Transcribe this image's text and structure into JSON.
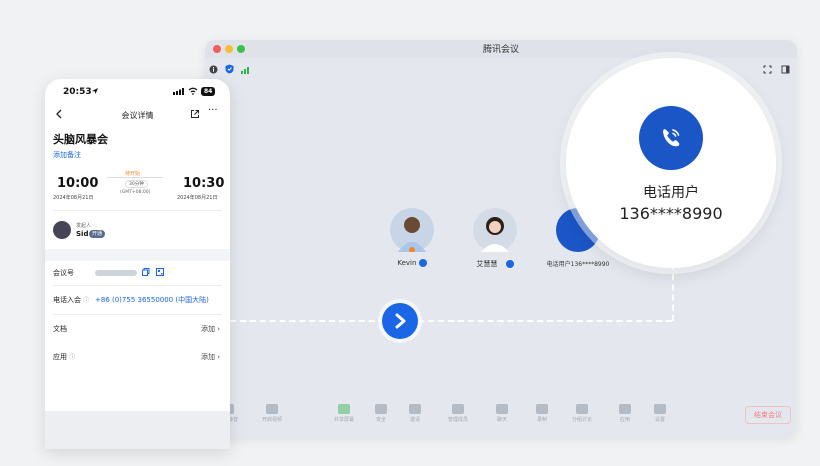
{
  "desktop": {
    "window_title": "腾讯会议",
    "participants": [
      {
        "name": "Kevin"
      },
      {
        "name": "艾慧慧"
      },
      {
        "name": "电话用户136****8990"
      }
    ],
    "toolbar": {
      "items": [
        "解除静音",
        "开启视频",
        "共享屏幕",
        "安全",
        "邀请",
        "管理成员",
        "聊天",
        "录制",
        "分组讨论",
        "应用",
        "设置"
      ],
      "leave_label": "结束会议"
    }
  },
  "zoom_bubble": {
    "label": "电话用户",
    "number": "136****8990"
  },
  "phone": {
    "status_time": "20:53",
    "battery": "84",
    "nav_title": "会议详情",
    "meeting_title": "头脑风暴会",
    "add_note": "添加备注",
    "start_time": "10:00",
    "start_date": "2024年08月21日",
    "status_badge": "待开始",
    "duration": "30分钟",
    "timezone": "(GMT+08:00)",
    "end_time": "10:30",
    "end_date": "2024年08月21日",
    "host_label": "发起人",
    "host_name": "Sid",
    "host_badge": "开通",
    "meeting_id_label": "会议号",
    "phone_join_label": "电话入会",
    "phone_join_number": "+86 (0)755 36550000 (中国大陆)",
    "docs_label": "文档",
    "docs_action": "添加",
    "apps_label": "应用",
    "apps_action": "添加"
  },
  "colors": {
    "accent_blue": "#1a66e6",
    "call_blue": "#1a56c6"
  }
}
